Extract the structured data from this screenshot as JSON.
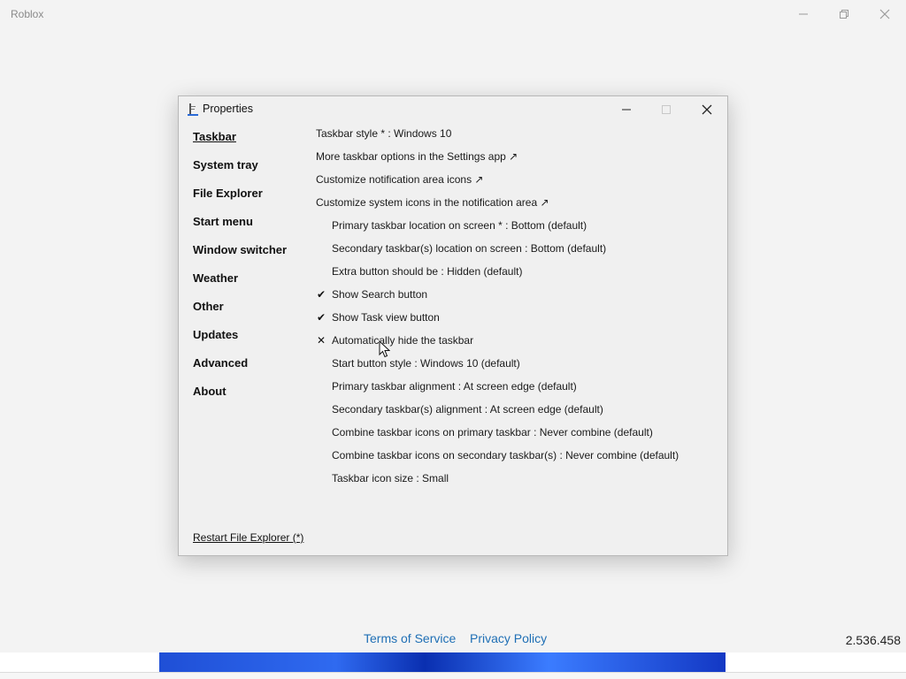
{
  "app": {
    "title": "Roblox",
    "version": "2.536.458",
    "footer_links": [
      "Terms of Service",
      "Privacy Policy"
    ],
    "accent_link_color": "#1f6fb5"
  },
  "dialog": {
    "title": "Properties",
    "nav": [
      {
        "label": "Taskbar",
        "active": true
      },
      {
        "label": "System tray"
      },
      {
        "label": "File Explorer"
      },
      {
        "label": "Start menu"
      },
      {
        "label": "Window switcher"
      },
      {
        "label": "Weather"
      },
      {
        "label": "Other"
      },
      {
        "label": "Updates"
      },
      {
        "label": "Advanced"
      },
      {
        "label": "About"
      }
    ],
    "options": [
      {
        "label": "Taskbar style * : Windows 10",
        "mark": ""
      },
      {
        "label": "More taskbar options in the Settings app ↗",
        "mark": ""
      },
      {
        "label": "Customize notification area icons ↗",
        "mark": ""
      },
      {
        "label": "Customize system icons in the notification area ↗",
        "mark": ""
      },
      {
        "label": "Primary taskbar location on screen * : Bottom (default)",
        "mark": ""
      },
      {
        "label": "Secondary taskbar(s) location on screen : Bottom (default)",
        "mark": ""
      },
      {
        "label": "Extra button should be : Hidden (default)",
        "mark": ""
      },
      {
        "label": "Show Search button",
        "mark": "✔"
      },
      {
        "label": "Show Task view button",
        "mark": "✔"
      },
      {
        "label": "Automatically hide the taskbar",
        "mark": "✕"
      },
      {
        "label": "Start button style : Windows 10 (default)",
        "mark": ""
      },
      {
        "label": "Primary taskbar alignment : At screen edge (default)",
        "mark": ""
      },
      {
        "label": "Secondary taskbar(s) alignment : At screen edge (default)",
        "mark": ""
      },
      {
        "label": "Combine taskbar icons on primary taskbar : Never combine (default)",
        "mark": ""
      },
      {
        "label": "Combine taskbar icons on secondary taskbar(s) : Never combine (default)",
        "mark": ""
      },
      {
        "label": "Taskbar icon size : Small",
        "mark": ""
      }
    ],
    "restart_link": "Restart File Explorer (*)"
  }
}
